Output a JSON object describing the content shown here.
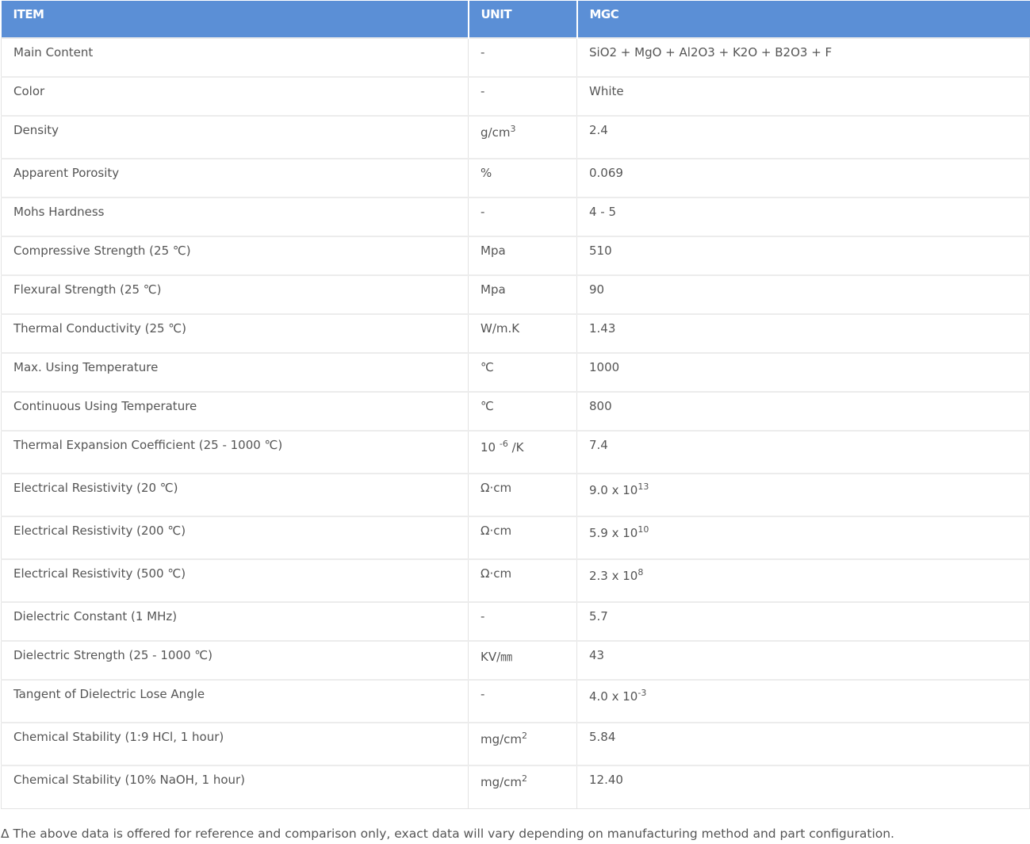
{
  "table": {
    "headers": [
      "ITEM",
      "UNIT",
      "MGC"
    ],
    "rows": [
      {
        "item": "Main Content",
        "unit": "-",
        "value": "SiO2 + MgO + Al2O3 + K2O + B2O3 + F"
      },
      {
        "item": "Color",
        "unit": "-",
        "value": "White"
      },
      {
        "item": "Density",
        "unit": "g/cm",
        "unit_sup": "3",
        "value": "2.4"
      },
      {
        "item": "Apparent Porosity",
        "unit": "%",
        "value": "0.069"
      },
      {
        "item": "Mohs Hardness",
        "unit": "-",
        "value": "4 - 5"
      },
      {
        "item": "Compressive Strength (25 ℃)",
        "unit": "Mpa",
        "value": "510"
      },
      {
        "item": "Flexural Strength (25 ℃)",
        "unit": "Mpa",
        "value": "90"
      },
      {
        "item": "Thermal Conductivity (25 ℃)",
        "unit": "W/m.K",
        "value": "1.43"
      },
      {
        "item": "Max. Using Temperature",
        "unit": "℃",
        "value": "1000"
      },
      {
        "item": "Continuous Using Temperature",
        "unit": "℃",
        "value": "800"
      },
      {
        "item": "Thermal Expansion Coefficient (25 - 1000 ℃)",
        "unit": "10",
        "unit_sup": "-6",
        "unit_suffix": "/K",
        "value": "7.4"
      },
      {
        "item": "Electrical Resistivity (20 ℃)",
        "unit": "Ω·cm",
        "value": "9.0 x 10",
        "value_sup": "13"
      },
      {
        "item": "Electrical Resistivity (200 ℃)",
        "unit": "Ω·cm",
        "value": "5.9 x 10",
        "value_sup": "10"
      },
      {
        "item": "Electrical Resistivity (500 ℃)",
        "unit": "Ω·cm",
        "value": "2.3 x 10",
        "value_sup": "8"
      },
      {
        "item": "Dielectric Constant (1 MHz)",
        "unit": "-",
        "value": "5.7"
      },
      {
        "item": "Dielectric Strength (25 - 1000 ℃)",
        "unit": "KV/㎜",
        "value": "43"
      },
      {
        "item": "Tangent of Dielectric Lose Angle",
        "unit": "-",
        "value": "4.0 x 10",
        "value_sup": "-3"
      },
      {
        "item": "Chemical Stability (1:9 HCl, 1 hour)",
        "unit": "mg/cm",
        "unit_sup": "2",
        "value": "5.84"
      },
      {
        "item": "Chemical Stability (10% NaOH, 1 hour)",
        "unit": "mg/cm",
        "unit_sup": "2",
        "value": "12.40"
      }
    ]
  },
  "footnote": "Δ The above data is offered for reference and comparison only, exact data will vary depending on manufacturing method and part configuration.",
  "colors": {
    "header_bg": "#5b8fd6",
    "header_text": "#ffffff",
    "body_text": "#555555",
    "border": "#e3e3e3"
  }
}
